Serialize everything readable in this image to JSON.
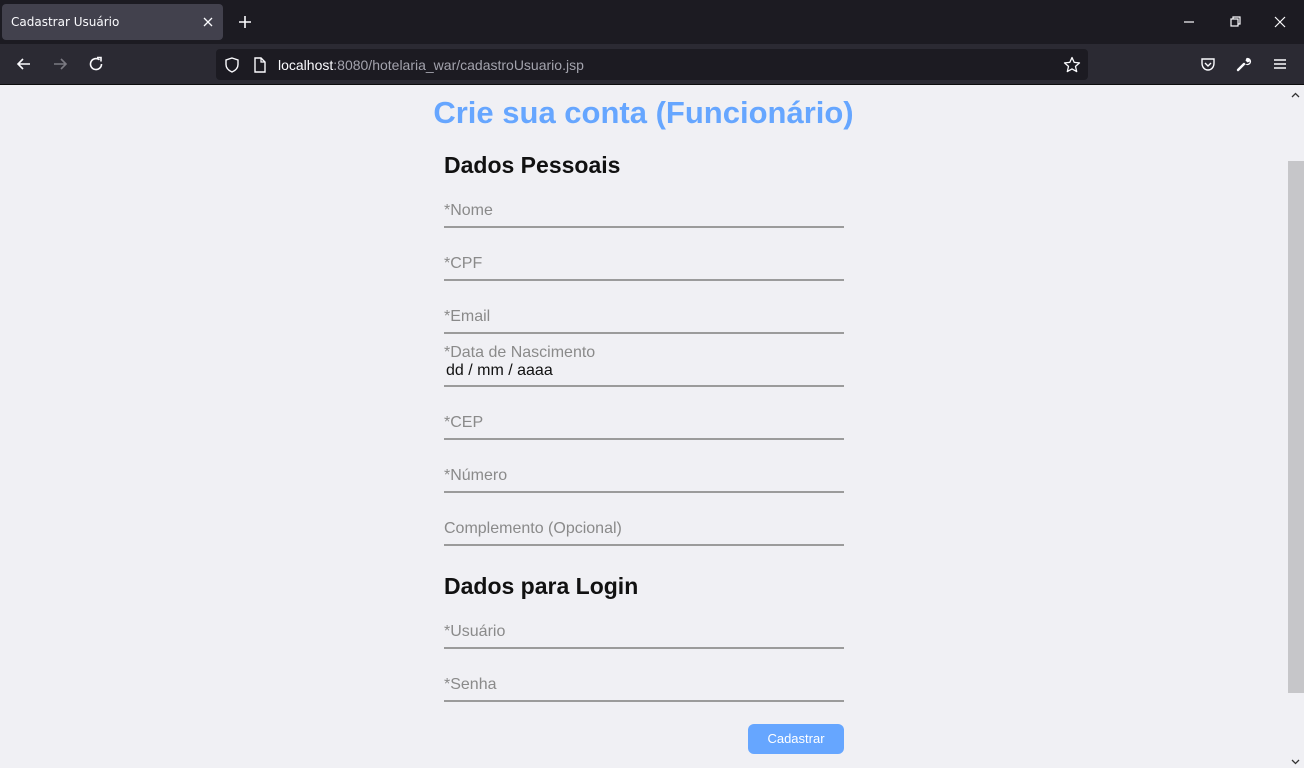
{
  "browser": {
    "tab_title": "Cadastrar Usuário",
    "url_host": "localhost",
    "url_rest": ":8080/hotelaria_war/cadastroUsuario.jsp"
  },
  "page": {
    "title": "Crie sua conta (Funcionário)",
    "personal_section": "Dados Pessoais",
    "login_section": "Dados para Login",
    "fields": {
      "nome": "*Nome",
      "cpf": "*CPF",
      "email": "*Email",
      "nascimento_label": "*Data de Nascimento",
      "nascimento_value": "dd / mm / aaaa",
      "cep": "*CEP",
      "numero": "*Número",
      "complemento": "Complemento (Opcional)",
      "usuario": "*Usuário",
      "senha": "*Senha"
    },
    "submit_label": "Cadastrar"
  },
  "colors": {
    "accent": "#66a6ff",
    "chrome_dark": "#1c1b22",
    "toolbar": "#2b2a33",
    "page_bg": "#f0f0f4"
  },
  "icons": [
    "close-icon",
    "plus-icon",
    "minimize-icon",
    "restore-icon",
    "window-close-icon",
    "back-arrow-icon",
    "forward-arrow-icon",
    "reload-icon",
    "shield-icon",
    "page-icon",
    "star-icon",
    "pocket-icon",
    "wrench-icon",
    "menu-icon",
    "chevron-up-icon",
    "chevron-down-icon"
  ]
}
